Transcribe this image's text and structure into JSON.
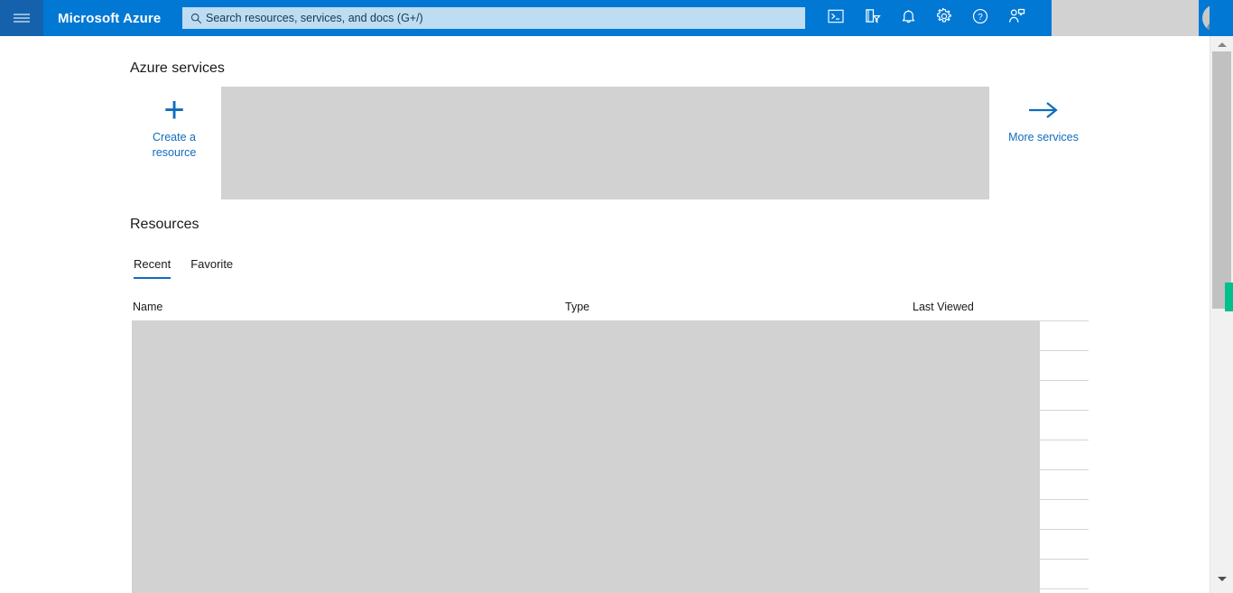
{
  "header": {
    "menu_icon": "hamburger-icon",
    "brand": "Microsoft Azure",
    "search": {
      "icon": "search-icon",
      "placeholder": "Search resources, services, and docs (G+/)",
      "value": ""
    },
    "icons": [
      {
        "name": "cloud-shell-icon",
        "title": "Cloud Shell"
      },
      {
        "name": "directory-filter-icon",
        "title": "Directories + subscriptions"
      },
      {
        "name": "notifications-bell-icon",
        "title": "Notifications"
      },
      {
        "name": "settings-gear-icon",
        "title": "Settings"
      },
      {
        "name": "help-question-icon",
        "title": "Help"
      },
      {
        "name": "feedback-person-icon",
        "title": "Feedback"
      }
    ],
    "avatar": "user-avatar"
  },
  "azure_services": {
    "title": "Azure services",
    "create_resource": {
      "icon": "plus-icon",
      "label_line1": "Create a",
      "label_line2": "resource"
    },
    "more_services": {
      "icon": "arrow-right-icon",
      "label": "More services"
    }
  },
  "resources": {
    "title": "Resources",
    "tabs": [
      {
        "label": "Recent",
        "active": true
      },
      {
        "label": "Favorite",
        "active": false
      }
    ],
    "columns": [
      "Name",
      "Type",
      "Last Viewed"
    ],
    "rows": []
  },
  "scrollbar": {
    "up_arrow": "scroll-up-arrow-icon",
    "down_arrow": "scroll-down-arrow-icon",
    "marker_color": "#00c08b"
  },
  "colors": {
    "azure_blue": "#0078d4",
    "menu_blue": "#1661ac",
    "link_blue": "#0f6cbd",
    "search_bg": "#bedcf2",
    "placeholder_gray": "#d2d2d2",
    "marker_green": "#00c08b"
  }
}
